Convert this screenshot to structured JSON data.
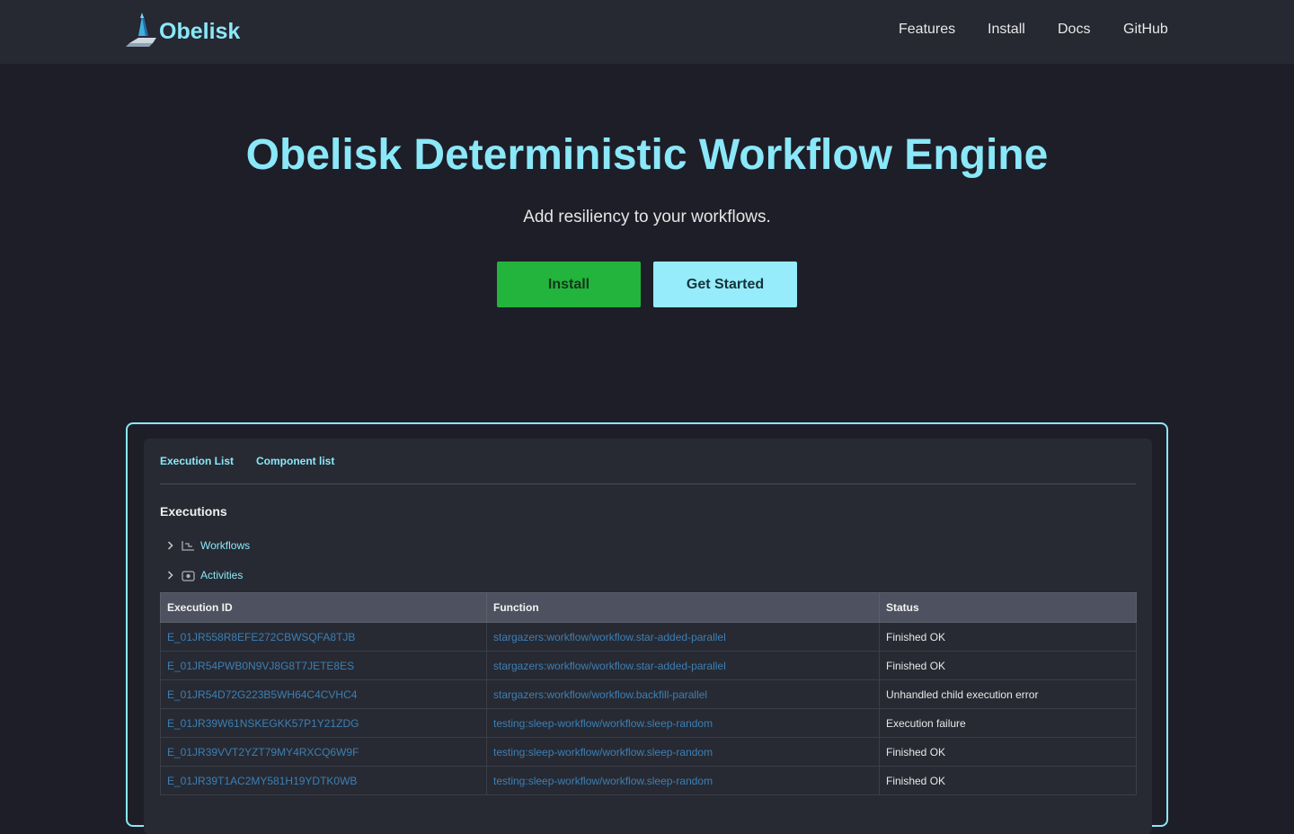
{
  "nav": {
    "brand": "Obelisk",
    "logo_icon": "obelisk-logo",
    "links": [
      "Features",
      "Install",
      "Docs",
      "GitHub"
    ]
  },
  "hero": {
    "title": "Obelisk Deterministic Workflow Engine",
    "subtitle": "Add resiliency to your workflows.",
    "install_label": "Install",
    "get_started_label": "Get Started"
  },
  "colors": {
    "accent": "#8ae8f8",
    "install_button": "#22b43c",
    "get_started_button": "#96ecfa",
    "background": "#1e1e28",
    "link": "#3d7fb3"
  },
  "app": {
    "tabs": [
      "Execution List",
      "Component list"
    ],
    "section_title": "Executions",
    "tree": [
      {
        "label": "Workflows",
        "icon": "workflow-icon"
      },
      {
        "label": "Activities",
        "icon": "activity-icon"
      }
    ],
    "table": {
      "columns": [
        "Execution ID",
        "Function",
        "Status"
      ],
      "rows": [
        {
          "id": "E_01JR558R8EFE272CBWSQFA8TJB",
          "fn": "stargazers:workflow/workflow.star-added-parallel",
          "status": "Finished OK"
        },
        {
          "id": "E_01JR54PWB0N9VJ8G8T7JETE8ES",
          "fn": "stargazers:workflow/workflow.star-added-parallel",
          "status": "Finished OK"
        },
        {
          "id": "E_01JR54D72G223B5WH64C4CVHC4",
          "fn": "stargazers:workflow/workflow.backfill-parallel",
          "status": "Unhandled child execution error"
        },
        {
          "id": "E_01JR39W61NSKEGKK57P1Y21ZDG",
          "fn": "testing:sleep-workflow/workflow.sleep-random",
          "status": "Execution failure"
        },
        {
          "id": "E_01JR39VVT2YZT79MY4RXCQ6W9F",
          "fn": "testing:sleep-workflow/workflow.sleep-random",
          "status": "Finished OK"
        },
        {
          "id": "E_01JR39T1AC2MY581H19YDTK0WB",
          "fn": "testing:sleep-workflow/workflow.sleep-random",
          "status": "Finished OK"
        }
      ]
    }
  }
}
